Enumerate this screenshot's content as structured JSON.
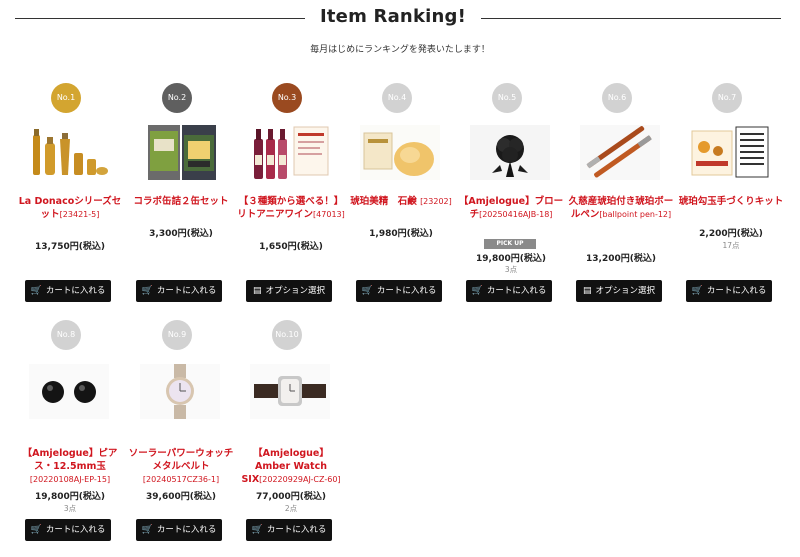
{
  "header": {
    "title": "Item Ranking!",
    "subtitle": "毎月はじめにランキングを発表いたします！"
  },
  "labels": {
    "cart": "カートに入れる",
    "option": "オプション選択",
    "pickup": "PICK UP"
  },
  "icons": {
    "cart": "cart-icon",
    "option": "database-icon"
  },
  "colors": {
    "gold": "#d3a530",
    "silver": "#5f5f5f",
    "bronze": "#9a4a20",
    "grey": "#d2d2d2",
    "name": "#d0161f",
    "button": "#111111"
  },
  "items": [
    {
      "rank": "No.1",
      "name": "La Donacoシリーズセット",
      "code": "[23421-5]",
      "price": "13,750円(税込)",
      "count": "",
      "button": "cart"
    },
    {
      "rank": "No.2",
      "name": "コラボ缶詰２缶セット",
      "code": "",
      "price": "3,300円(税込)",
      "count": "",
      "button": "cart"
    },
    {
      "rank": "No.3",
      "name": "【３種類から選べる！】リトアニアワイン",
      "code": "[47013]",
      "price": "1,650円(税込)",
      "count": "",
      "button": "option"
    },
    {
      "rank": "No.4",
      "name": "琥珀美精　石鹸",
      "code": "[23202]",
      "price": "1,980円(税込)",
      "count": "",
      "button": "cart"
    },
    {
      "rank": "No.5",
      "name": "【Amjelogue】ブローチ",
      "code": "[20250416AJB-18]",
      "price": "19,800円(税込)",
      "count": "3点",
      "button": "cart",
      "pickup": true
    },
    {
      "rank": "No.6",
      "name": "久慈産琥珀付き琥珀ボールペン",
      "code": "[ballpoint pen-12]",
      "price": "13,200円(税込)",
      "count": "",
      "button": "option"
    },
    {
      "rank": "No.7",
      "name": "琥珀勾玉手づくりキット",
      "code": "",
      "price": "2,200円(税込)",
      "count": "17点",
      "button": "cart"
    },
    {
      "rank": "No.8",
      "name": "【Amjelogue】ピアス・12.5mm玉",
      "code": "[20220108AJ-EP-15]",
      "price": "19,800円(税込)",
      "count": "3点",
      "button": "cart"
    },
    {
      "rank": "No.9",
      "name": "ソーラーパワーウォッチ メタルベルト",
      "code": "[20240517CZ36-1]",
      "price": "39,600円(税込)",
      "count": "",
      "button": "cart"
    },
    {
      "rank": "No.10",
      "name": "【Amjelogue】Amber Watch SIX",
      "code": "[20220929AJ-CZ-60]",
      "price": "77,000円(税込)",
      "count": "2点",
      "button": "cart"
    }
  ]
}
